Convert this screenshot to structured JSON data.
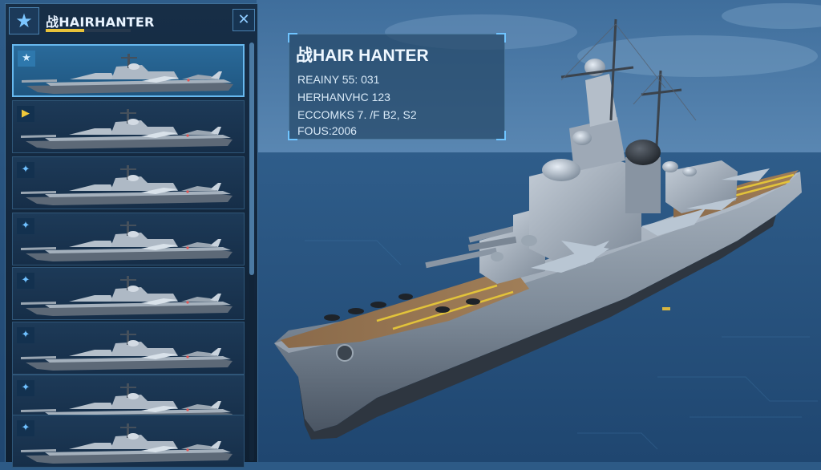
{
  "list_panel": {
    "title": "战HAIRHANTER",
    "progress": 0.45,
    "close_label": "✕",
    "star_icon": "star-icon",
    "ships": [
      {
        "icon": "★",
        "icon_name": "star-icon",
        "selected": true
      },
      {
        "icon": "▶",
        "icon_name": "play-icon",
        "selected": false
      },
      {
        "icon": "✦",
        "icon_name": "sparkle-icon",
        "selected": false
      },
      {
        "icon": "✦",
        "icon_name": "sparkle-icon",
        "selected": false
      },
      {
        "icon": "✦",
        "icon_name": "sparkle-icon",
        "selected": false
      },
      {
        "icon": "✦",
        "icon_name": "sparkle-icon",
        "selected": false
      },
      {
        "icon": "✦",
        "icon_name": "sparkle-icon",
        "selected": false
      },
      {
        "icon": "✦",
        "icon_name": "sparkle-icon",
        "selected": false
      }
    ]
  },
  "info": {
    "title": "战HAIR HANTER",
    "lines": [
      "REAINY 55:  031",
      "HERHANVHC 123",
      "ECCOMKS 7. /F B2, S2",
      "FOUS:2006"
    ]
  },
  "colors": {
    "accent": "#67b8ee",
    "progress": "#e8c23a",
    "sea": "#2d5a86"
  }
}
